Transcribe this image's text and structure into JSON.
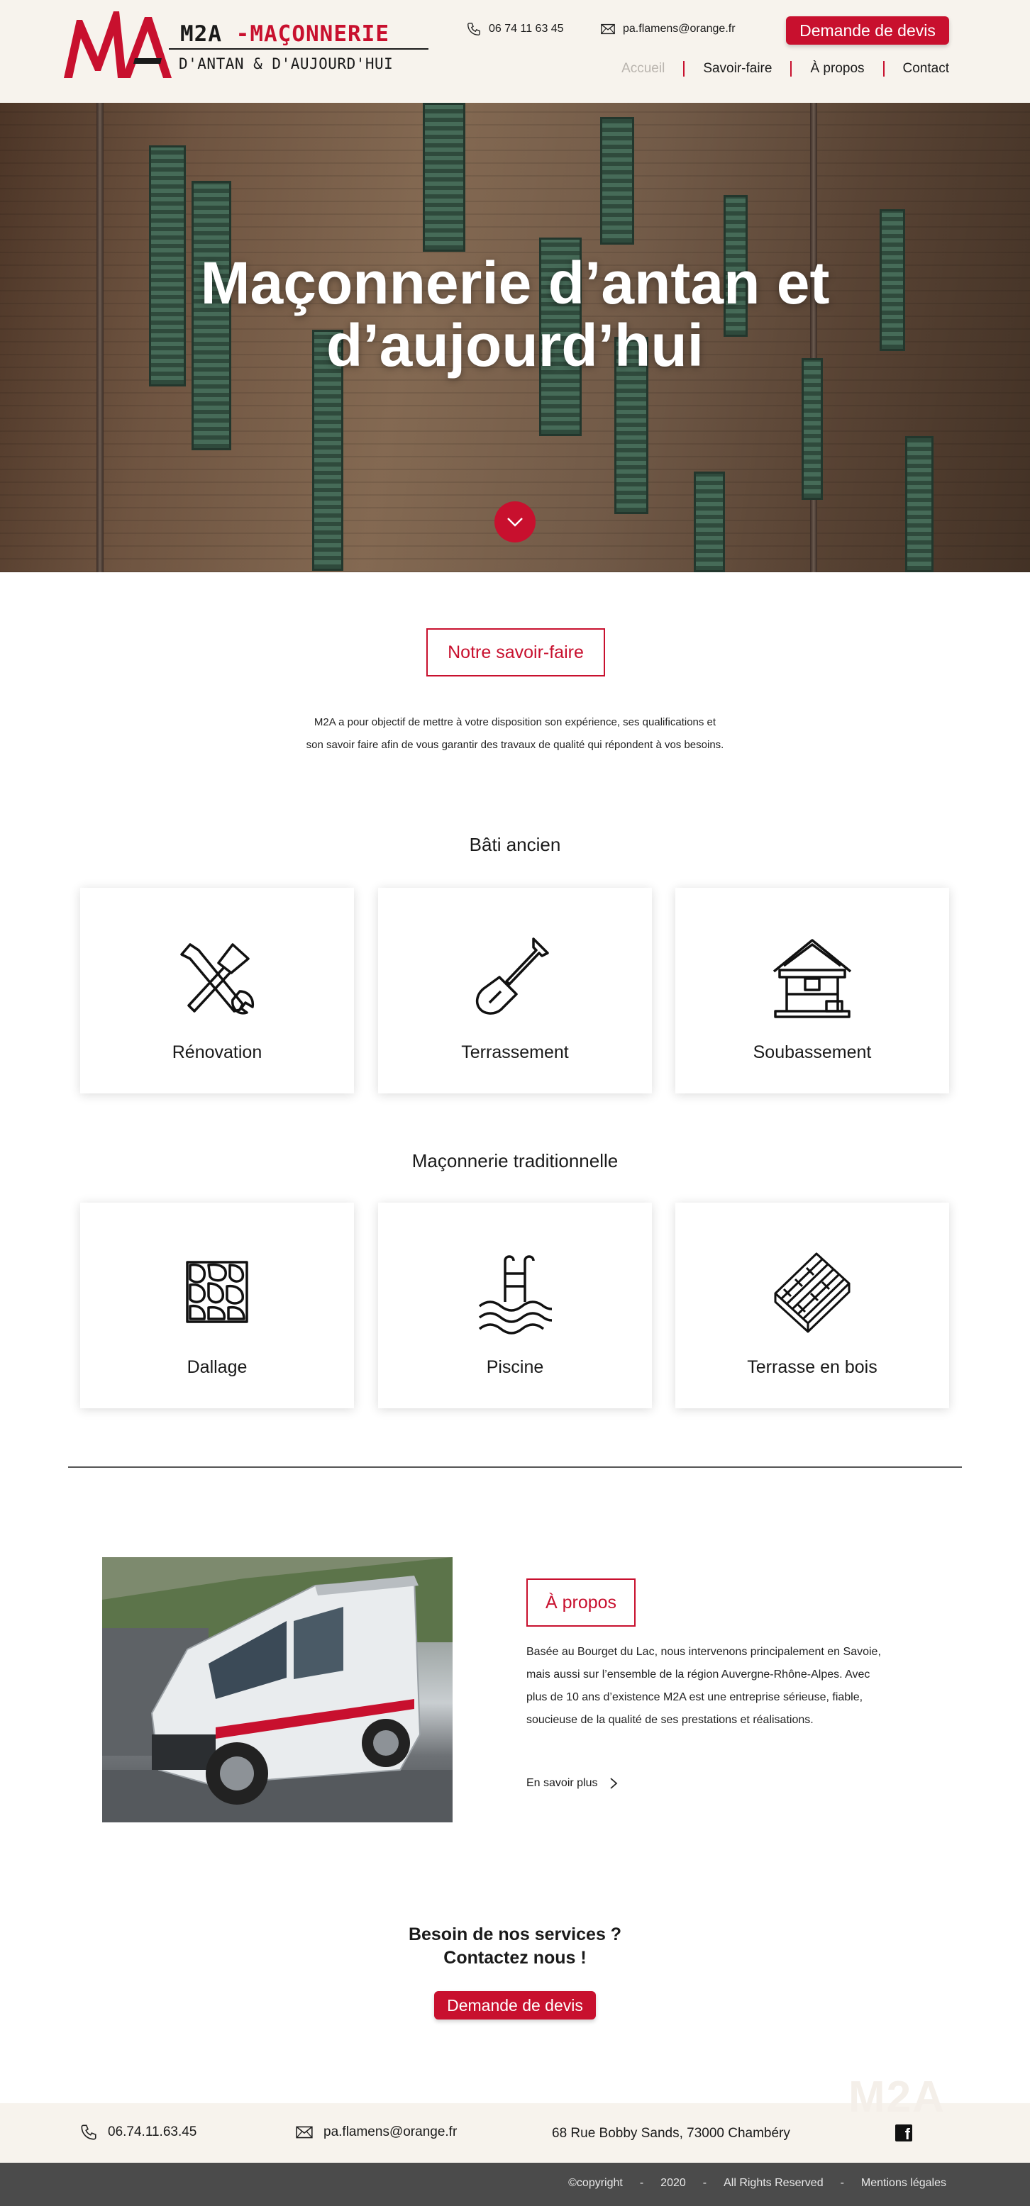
{
  "header": {
    "brand_prefix": "M2A",
    "brand_name": "MAÇONNERIE",
    "tagline": "D'ANTAN & D'AUJOURD'HUI",
    "phone": "06 74 11 63 45",
    "email": "pa.flamens@orange.fr",
    "quote_button": "Demande de devis",
    "nav": [
      {
        "label": "Accueil",
        "active": true
      },
      {
        "label": "Savoir-faire",
        "active": false
      },
      {
        "label": "À propos",
        "active": false
      },
      {
        "label": "Contact",
        "active": false
      }
    ]
  },
  "hero": {
    "title_line1": "Maçonnerie d’antan et",
    "title_line2": "d’aujourd’hui"
  },
  "savoir_faire": {
    "button": "Notre savoir-faire",
    "intro_line1": "M2A a pour objectif de mettre à votre disposition son expérience, ses qualifications et",
    "intro_line2": "son savoir faire afin de vous garantir des travaux de qualité qui répondent à vos besoins."
  },
  "bati_ancien": {
    "title": "Bâti ancien",
    "cards": [
      {
        "label": "Rénovation",
        "icon": "tools-icon"
      },
      {
        "label": "Terrassement",
        "icon": "shovel-icon"
      },
      {
        "label": "Soubassement",
        "icon": "house-frame-icon"
      }
    ]
  },
  "maconnerie": {
    "title": "Maçonnerie traditionnelle",
    "cards": [
      {
        "label": "Dallage",
        "icon": "paving-icon"
      },
      {
        "label": "Piscine",
        "icon": "pool-icon"
      },
      {
        "label": "Terrasse  en bois",
        "icon": "wood-deck-icon"
      }
    ]
  },
  "about": {
    "button": "À propos",
    "text": "Basée au Bourget du Lac, nous intervenons principalement en Savoie, mais aussi sur l’ensemble de la région Auvergne-Rhône-Alpes. Avec plus de 10 ans d’existence M2A est une entreprise sérieuse, fiable, soucieuse de la qualité de ses prestations et réalisations.",
    "more_link": "En savoir plus"
  },
  "cta": {
    "line1": "Besoin de nos services ?",
    "line2": "Contactez nous !",
    "button": "Demande de devis"
  },
  "footer": {
    "watermark": "M2A",
    "phone": "06.74.11.63.45",
    "email": "pa.flamens@orange.fr",
    "address": "68 Rue Bobby Sands, 73000 Chambéry",
    "copyright": "©copyright",
    "year": "2020",
    "rights": "All Rights Reserved",
    "legal": "Mentions légales",
    "dot": "-"
  },
  "colors": {
    "accent": "#c8102e",
    "header_bg": "#f7f3ed",
    "bottombar_bg": "#4b4b4b"
  }
}
